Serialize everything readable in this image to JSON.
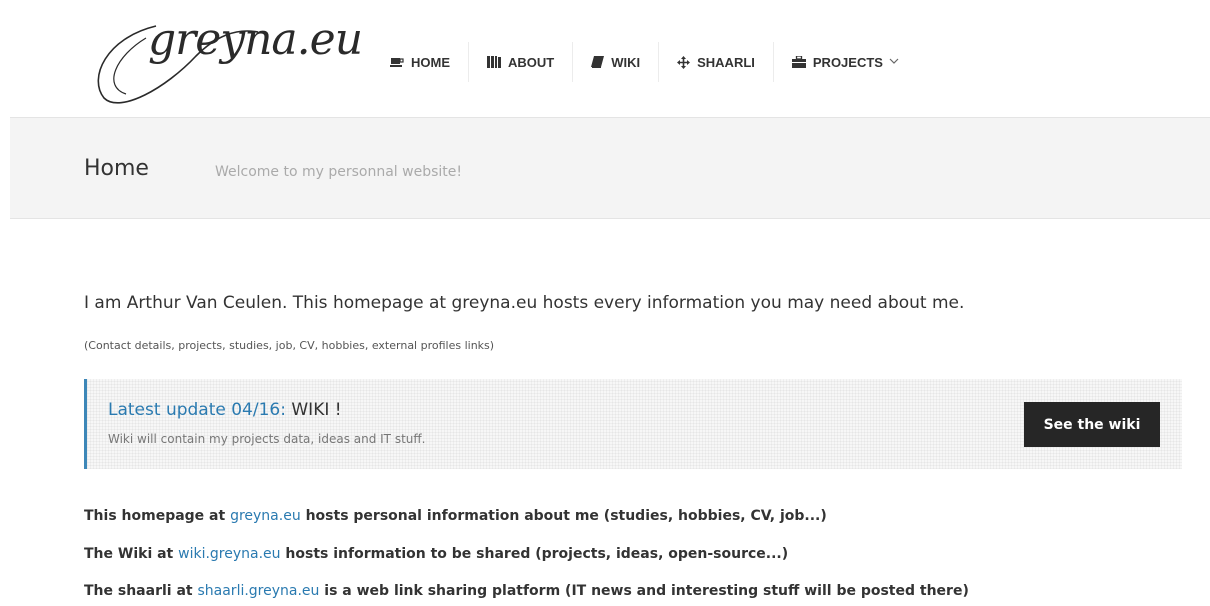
{
  "logo": {
    "text": "greyna.eu"
  },
  "nav": {
    "items": [
      {
        "label": "HOME",
        "icon": "coffee-icon"
      },
      {
        "label": "ABOUT",
        "icon": "books-icon"
      },
      {
        "label": "WIKI",
        "icon": "book-icon"
      },
      {
        "label": "SHAARLI",
        "icon": "move-arrows-icon"
      },
      {
        "label": "PROJECTS",
        "icon": "briefcase-icon",
        "chevron": "chevron-down-icon"
      }
    ]
  },
  "titlebar": {
    "title": "Home",
    "subtitle": "Welcome to my personnal website!"
  },
  "intro": {
    "heading": "I am Arthur Van Ceulen. This homepage at greyna.eu hosts every information you may need about me.",
    "sub": "(Contact details, projects, studies, job, CV, hobbies, external profiles links)"
  },
  "callout": {
    "title_highlight": "Latest update 04/16:",
    "title_rest": " WIKI !",
    "description": "Wiki will contain my projects data, ideas and IT stuff.",
    "button_label": "See the wiki",
    "accent": "#3d87b8"
  },
  "links": [
    {
      "prefix": "This homepage at ",
      "link": "greyna.eu",
      "suffix": " hosts personal information about me (studies, hobbies, CV, job...)"
    },
    {
      "prefix": "The Wiki at ",
      "link": "wiki.greyna.eu",
      "suffix": " hosts information to be shared (projects, ideas, open-source...)"
    },
    {
      "prefix": "The shaarli at ",
      "link": "shaarli.greyna.eu",
      "suffix": " is a web link sharing platform (IT news and interesting stuff will be posted there)"
    }
  ],
  "colors": {
    "link": "#2a7ab0",
    "button_bg": "#262626",
    "title_bg": "#f4f4f4"
  }
}
